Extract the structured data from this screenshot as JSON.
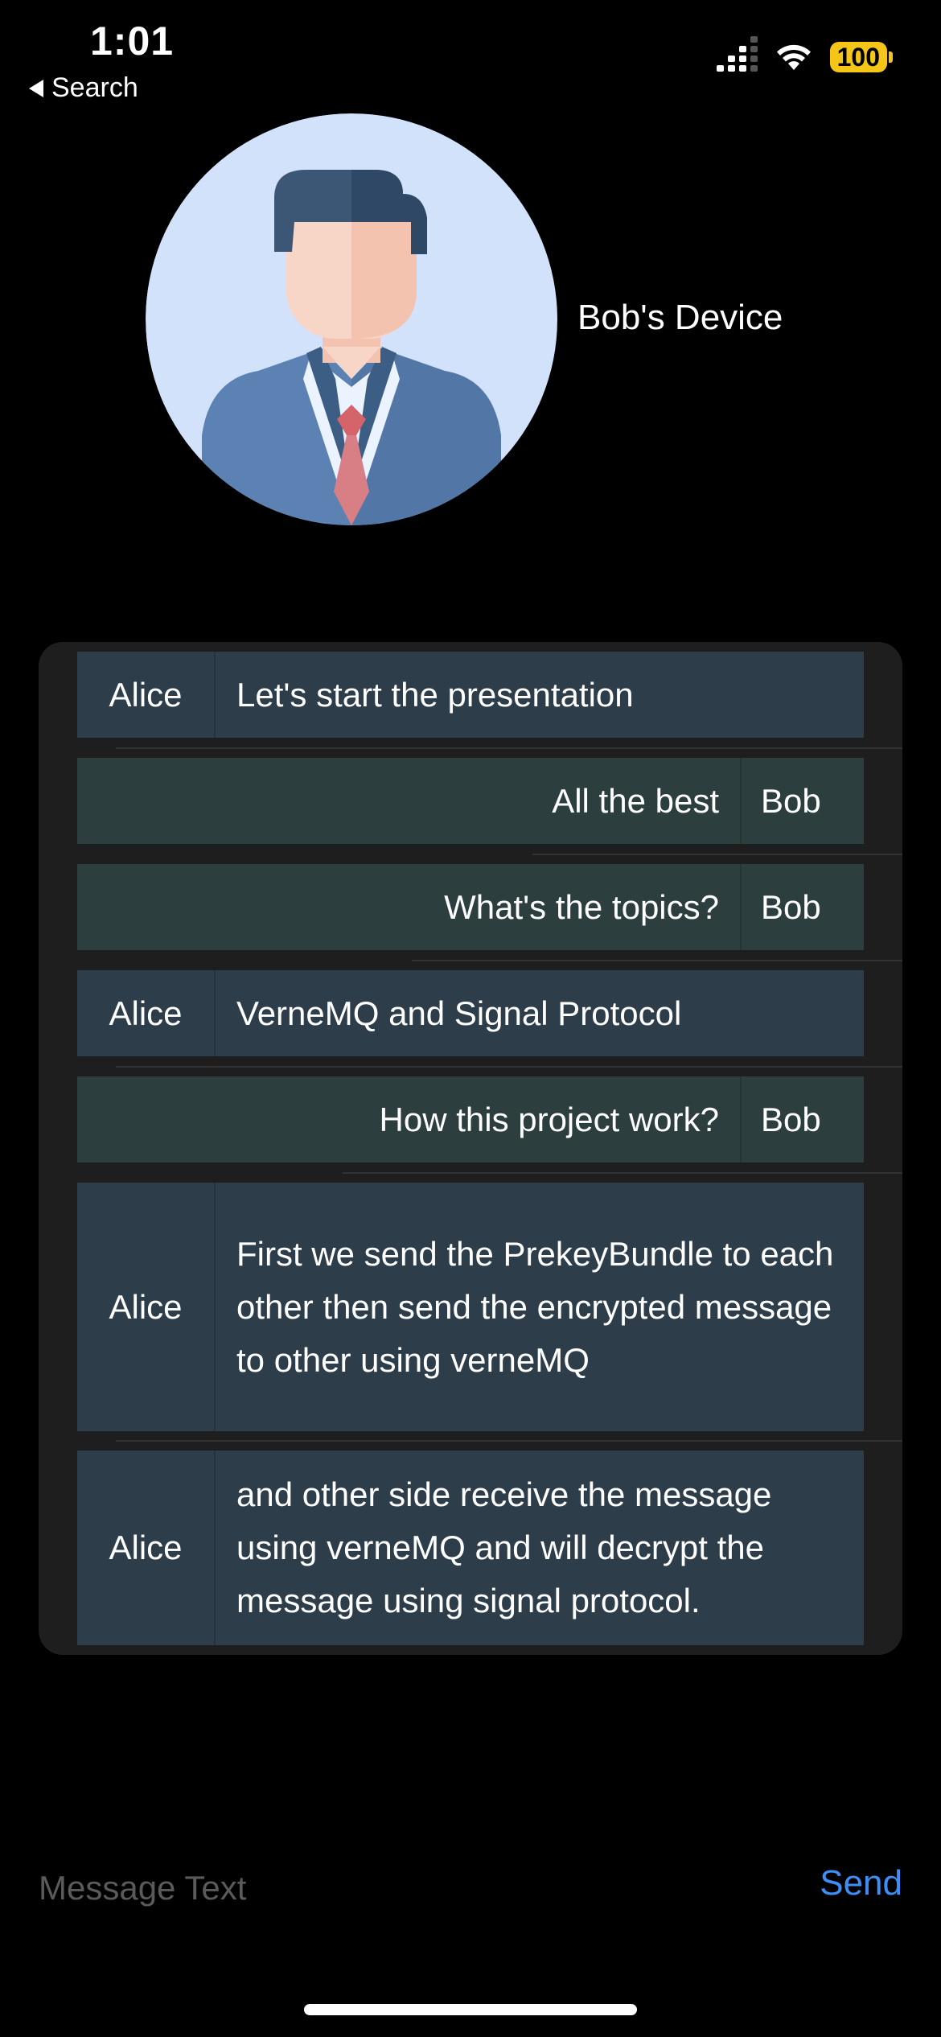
{
  "status_bar": {
    "time": "1:01",
    "back_label": "Search",
    "battery": "100"
  },
  "header": {
    "device_name": "Bob's Device"
  },
  "messages": [
    {
      "sender": "Alice",
      "text": "Let's start the presentation"
    },
    {
      "sender": "Bob",
      "text": "All the best"
    },
    {
      "sender": "Bob",
      "text": "What's the topics?"
    },
    {
      "sender": "Alice",
      "text": "VerneMQ and Signal Protocol"
    },
    {
      "sender": "Bob",
      "text": "How this project work?"
    },
    {
      "sender": "Alice",
      "text": "First we send the PrekeyBundle to each other then send the encrypted message to other using verneMQ"
    },
    {
      "sender": "Alice",
      "text": "and other side receive the message using verneMQ and will decrypt the message using signal protocol."
    }
  ],
  "composer": {
    "placeholder": "Message Text",
    "send_label": "Send"
  },
  "colors": {
    "alice_bubble": "#2e3d4a",
    "bob_bubble": "#2c3f3e",
    "send": "#3d8ef7",
    "battery": "#f5c518"
  }
}
